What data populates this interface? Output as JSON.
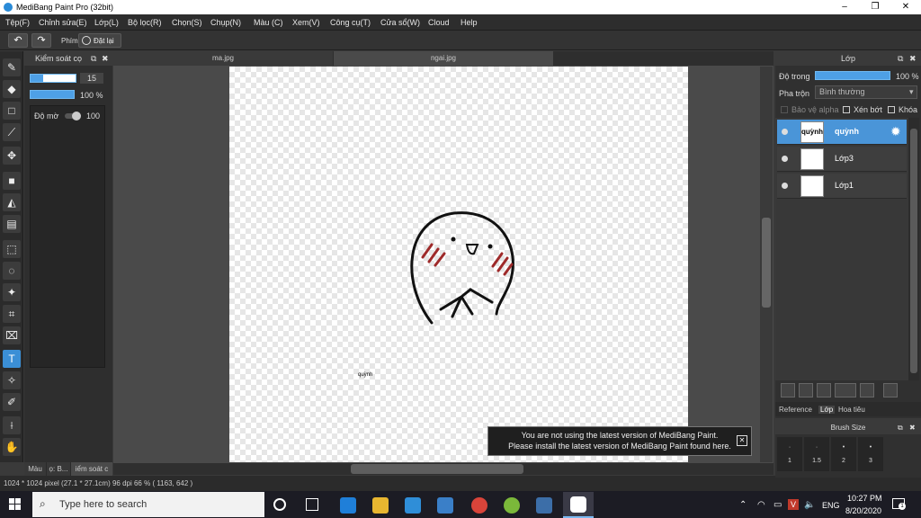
{
  "window": {
    "title": "MediBang Paint Pro (32bit)",
    "minimize": "–",
    "maximize": "❐",
    "close": "✕"
  },
  "menu": [
    "Tệp(F)",
    "Chỉnh sửa(E)",
    "Lớp(L)",
    "Bộ lọc(R)",
    "Chọn(S)",
    "Chụp(N)",
    "Màu (C)",
    "Xem(V)",
    "Công cụ(T)",
    "Cửa sổ(W)",
    "Cloud",
    "Help"
  ],
  "toolbar": {
    "undo": "↶",
    "redo": "↷",
    "key_label": "Phím",
    "reset_label": "Đặt lại"
  },
  "brush_panel": {
    "title": "Kiểm soát cọ",
    "size_value": "15",
    "opacity_value": "100 %",
    "hardness_label": "Độ mờ",
    "hardness_value": "100"
  },
  "tabs": [
    "ma.jpg",
    "ngai.jpg"
  ],
  "canvas_text": "quỳnh",
  "status": {
    "text": "1024 * 1024 pixel   (27.1 * 27.1cm)   96 dpi   66 %   ( 1163, 642 )"
  },
  "bottom_tabs": [
    "Màu",
    "ọ: B...",
    "iểm soát c"
  ],
  "layer_panel": {
    "title": "Lớp",
    "opacity_label": "Độ trong",
    "opacity_value": "100 %",
    "blend_label": "Pha trộn",
    "blend_value": "Bình thường",
    "protect_alpha": "Bảo vệ alpha",
    "clipping": "Xén bớt",
    "lock": "Khóa",
    "layers": [
      {
        "name": "quỳnh",
        "thumb_text": "quỳnh",
        "active": true
      },
      {
        "name": "Lớp3",
        "active": false
      },
      {
        "name": "Lớp1",
        "active": false
      }
    ],
    "bottom_tabs": [
      "Reference",
      "Lớp",
      "Hoa tiêu"
    ]
  },
  "brush_size": {
    "title": "Brush Size",
    "sizes": [
      "1",
      "1.5",
      "2",
      "3"
    ]
  },
  "toast": {
    "line1": "You are not using the latest version of MediBang Paint.",
    "line2": "Please install the latest version of MediBang Paint found here.",
    "close": "✕"
  },
  "taskbar": {
    "search_placeholder": "Type here to search",
    "lang": "ENG",
    "time": "10:27 PM",
    "date": "8/20/2020",
    "notifications": "1"
  }
}
